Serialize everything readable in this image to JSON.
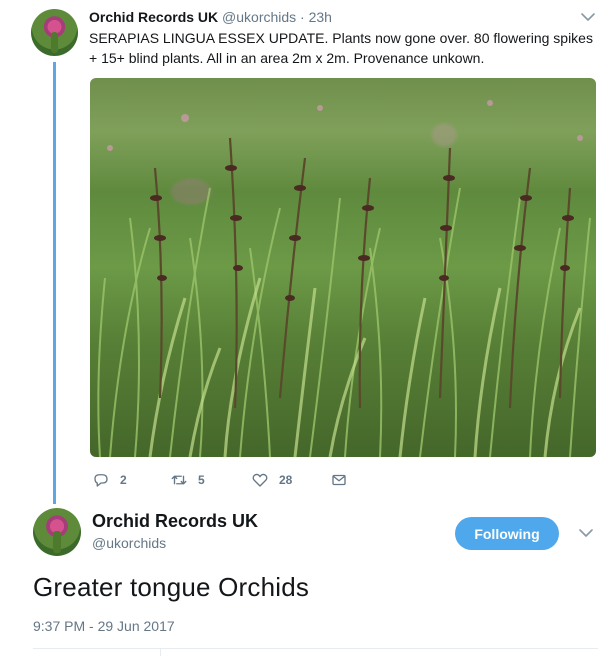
{
  "colors": {
    "accent": "#4fa8ec",
    "thread_line": "#5aa9e6",
    "text_primary": "#14171a",
    "text_secondary": "#657786"
  },
  "reply_tweet": {
    "avatar_icon": "orchid-avatar",
    "display_name": "Orchid Records UK",
    "handle_time": "@ukorchids · 23h",
    "text": "SERAPIAS LINGUA ESSEX UPDATE. Plants now gone over. 80 flowering spikes + 15+ blind plants. All in an area 2m x 2m. Provenance unkown.",
    "photo_icon": "grass-orchid-photo",
    "actions": {
      "reply_count": "2",
      "retweet_count": "5",
      "like_count": "28"
    }
  },
  "main_tweet": {
    "avatar_icon": "orchid-avatar",
    "display_name": "Orchid Records UK",
    "handle": "@ukorchids",
    "follow_label": "Following",
    "text": "Greater tongue Orchids",
    "timestamp": "9:37 PM - 29 Jun 2017"
  }
}
